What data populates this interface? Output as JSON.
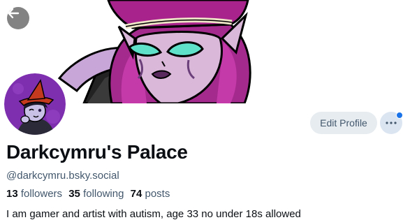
{
  "profile": {
    "display_name": "Darkcymru's Palace",
    "handle": "@darkcymru.bsky.social",
    "bio": "I am gamer and artist with autism, age 33 no under 18s allowed"
  },
  "stats": {
    "followers_count": "13",
    "followers_label": "followers",
    "following_count": "35",
    "following_label": "following",
    "posts_count": "74",
    "posts_label": "posts"
  },
  "actions": {
    "edit_profile_label": "Edit Profile"
  },
  "icons": {
    "back": "arrow-left-icon",
    "more": "ellipsis-icon",
    "notification": "notification-dot-icon"
  },
  "colors": {
    "accent": "#1a73e8",
    "muted_text": "#42576c",
    "button_bg": "#e7ecf1"
  }
}
